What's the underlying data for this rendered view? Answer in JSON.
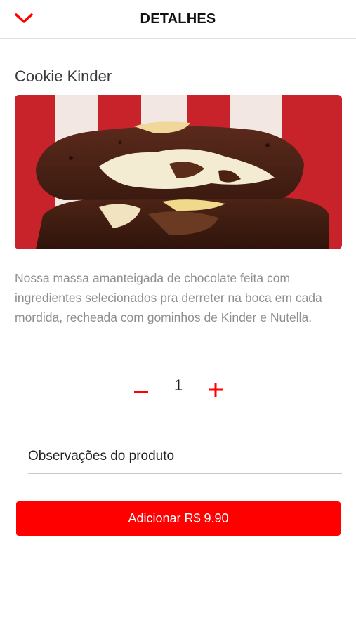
{
  "header": {
    "title": "DETALHES",
    "back_icon": "chevron-down-icon"
  },
  "product": {
    "name": "Cookie Kinder",
    "image_icon": "cookie-photo",
    "description": "Nossa massa amanteigada de chocolate feita com ingredientes selecionados pra derreter na boca em cada mordida, recheada com gominhos de Kinder e Nutella."
  },
  "quantity": {
    "value": "1",
    "minus_icon": "minus-icon",
    "plus_icon": "plus-icon"
  },
  "notes": {
    "placeholder": "Observações do produto",
    "value": ""
  },
  "add_button": {
    "label": "Adicionar",
    "price": "R$ 9.90"
  },
  "colors": {
    "accent": "#ff0000",
    "text_muted": "#8e8e8e"
  }
}
